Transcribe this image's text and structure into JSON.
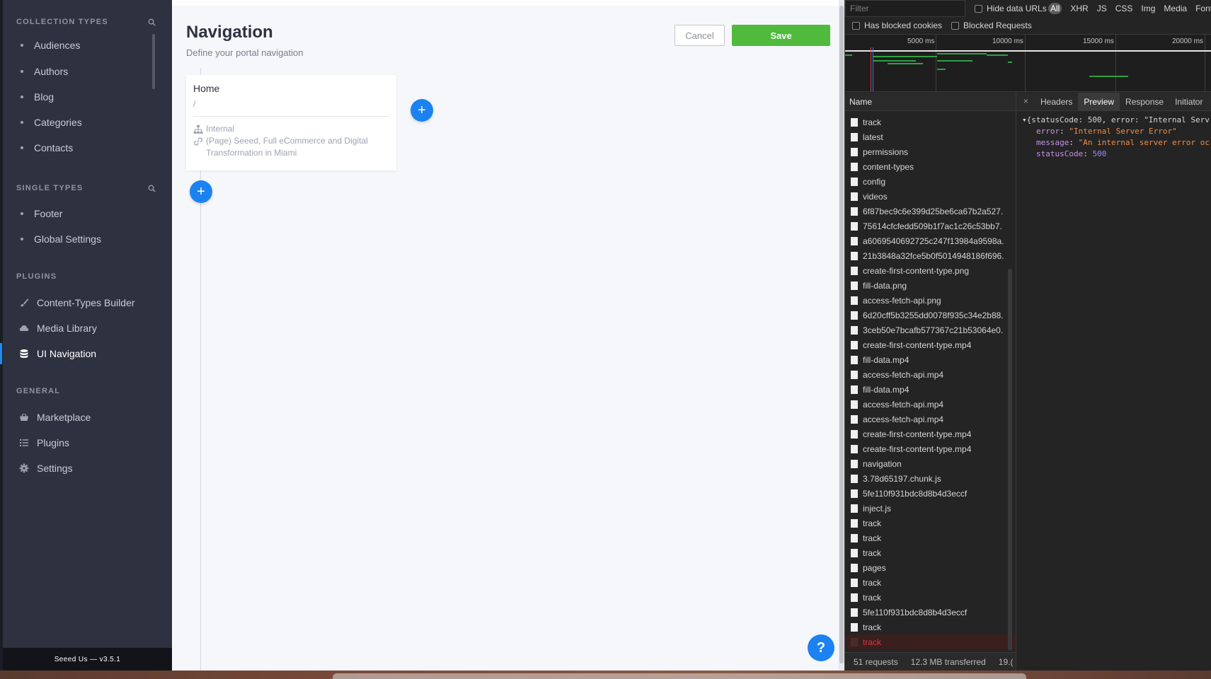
{
  "sidebar": {
    "sections": [
      {
        "title": "COLLECTION TYPES",
        "items": [
          "Audiences",
          "Authors",
          "Blog",
          "Categories",
          "Contacts"
        ]
      },
      {
        "title": "SINGLE TYPES",
        "items": [
          "Footer",
          "Global Settings"
        ]
      },
      {
        "title": "PLUGINS",
        "items": [
          "Content-Types Builder",
          "Media Library",
          "UI Navigation"
        ]
      },
      {
        "title": "GENERAL",
        "items": [
          "Marketplace",
          "Plugins",
          "Settings"
        ]
      }
    ],
    "footer": "Seeed Us  —  v3.5.1"
  },
  "main": {
    "title": "Navigation",
    "subtitle": "Define your portal navigation",
    "cancel_label": "Cancel",
    "save_label": "Save",
    "card": {
      "title": "Home",
      "path": "/",
      "type": "Internal",
      "link_line1": "(Page) Seeed, Full eCommerce and Digital",
      "link_line2": "Transformation in Miami"
    },
    "plus": "+",
    "help": "?"
  },
  "devtools": {
    "filter_placeholder": "Filter",
    "hide_data_urls": "Hide data URLs",
    "type_all": "All",
    "types": [
      "XHR",
      "JS",
      "CSS",
      "Img",
      "Media",
      "Font"
    ],
    "has_blocked_cookies": "Has blocked cookies",
    "blocked_requests": "Blocked Requests",
    "timeline_ticks": [
      "5000 ms",
      "10000 ms",
      "15000 ms",
      "20000 ms"
    ],
    "name_header": "Name",
    "close": "×",
    "tabs": [
      "Headers",
      "Preview",
      "Response",
      "Initiator"
    ],
    "active_tab": "Preview",
    "requests": [
      "track",
      "latest",
      "permissions",
      "content-types",
      "config",
      "videos",
      "6f87bec9c6e399d25be6ca67b2a527.",
      "75614cfcfedd509b1f7ac1c26c53bb7.",
      "a6069540692725c247f13984a9598a.",
      "21b3848a32fce5b0f5014948186f696.",
      "create-first-content-type.png",
      "fill-data.png",
      "access-fetch-api.png",
      "6d20cff5b3255dd0078f935c34e2b88.",
      "3ceb50e7bcafb577367c21b53064e0.",
      "create-first-content-type.mp4",
      "fill-data.mp4",
      "access-fetch-api.mp4",
      "fill-data.mp4",
      "access-fetch-api.mp4",
      "access-fetch-api.mp4",
      "create-first-content-type.mp4",
      "create-first-content-type.mp4",
      "navigation",
      "3.78d65197.chunk.js",
      "5fe110f931bdc8d8b4d3eccf",
      "inject.js",
      "track",
      "track",
      "track",
      "pages",
      "track",
      "track",
      "5fe110f931bdc8d8b4d3eccf",
      "track",
      "track"
    ],
    "error_index": 35,
    "preview": {
      "line1": "{statusCode: 500, error: \"Internal Serv",
      "error_key": "error",
      "error_val": "\"Internal Server Error\"",
      "message_key": "message",
      "message_val": "\"An internal server error oc",
      "status_key": "statusCode",
      "status_val": "500"
    },
    "status_requests": "51 requests",
    "status_transferred": "12.3 MB transferred",
    "status_more": "19.("
  },
  "colors": {
    "sidebar_bg": "#2e3240",
    "accent_blue": "#1c82f2",
    "save_green": "#4fba3c",
    "error_red": "#e0343a"
  }
}
